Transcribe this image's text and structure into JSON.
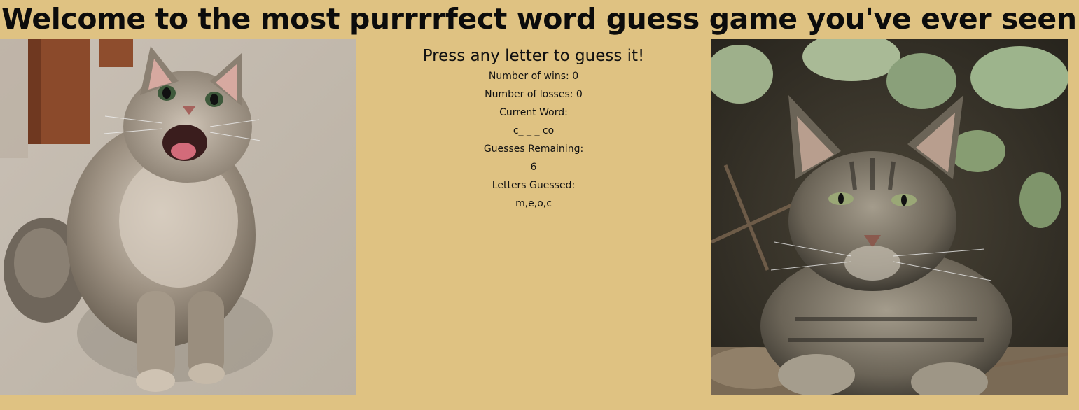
{
  "header": {
    "title": "Welcome to the most purrrrfect word guess game you've ever seen!"
  },
  "game": {
    "prompt": "Press any letter to guess it!",
    "wins_label": "Number of wins: 0",
    "losses_label": "Number of losses: 0",
    "current_word_label": "Current Word:",
    "current_word_value": "c_ _ _ co",
    "guesses_remaining_label": "Guesses Remaining:",
    "guesses_remaining_value": "6",
    "letters_guessed_label": "Letters Guessed:",
    "letters_guessed_value": "m,e,o,c"
  },
  "images": {
    "left": "happy-cat-photo",
    "right": "tabby-cat-photo"
  },
  "colors": {
    "background": "#dfc282",
    "text": "#111111"
  }
}
